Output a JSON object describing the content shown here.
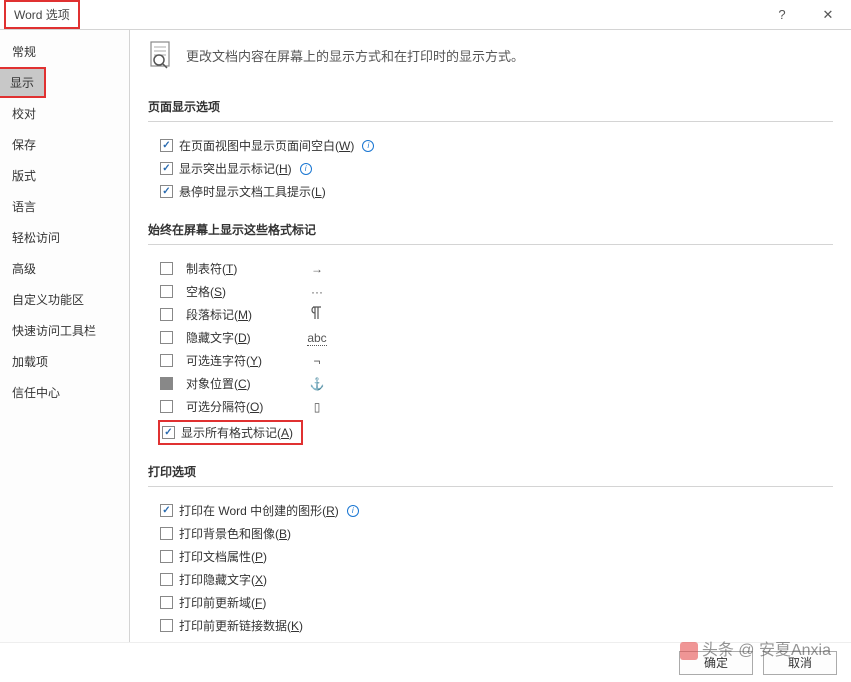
{
  "titlebar": {
    "title": "Word 选项",
    "help": "?",
    "close": "✕"
  },
  "sidebar": {
    "items": [
      "常规",
      "显示",
      "校对",
      "保存",
      "版式",
      "语言",
      "轻松访问",
      "高级",
      "自定义功能区",
      "快速访问工具栏",
      "加载项",
      "信任中心"
    ],
    "selected_index": 1
  },
  "heading": "更改文档内容在屏幕上的显示方式和在打印时的显示方式。",
  "sections": {
    "page_display": {
      "title": "页面显示选项",
      "opts": [
        {
          "checked": true,
          "label": "在页面视图中显示页面间空白(",
          "accel": "W",
          "tail": ")",
          "info": true
        },
        {
          "checked": true,
          "label": "显示突出显示标记(",
          "accel": "H",
          "tail": ")",
          "info": true
        },
        {
          "checked": true,
          "label": "悬停时显示文档工具提示(",
          "accel": "L",
          "tail": ")",
          "info": false
        }
      ]
    },
    "marks": {
      "title": "始终在屏幕上显示这些格式标记",
      "items": [
        {
          "checked": false,
          "label": "制表符(",
          "accel": "T",
          "tail": ")",
          "symbol": "→"
        },
        {
          "checked": false,
          "label": "空格(",
          "accel": "S",
          "tail": ")",
          "symbol": "···"
        },
        {
          "checked": false,
          "label": "段落标记(",
          "accel": "M",
          "tail": ")",
          "symbol": "¶",
          "symclass": ""
        },
        {
          "checked": false,
          "label": "隐藏文字(",
          "accel": "D",
          "tail": ")",
          "symbol": "abc",
          "symclass": "abc-strike"
        },
        {
          "checked": false,
          "label": "可选连字符(",
          "accel": "Y",
          "tail": ")",
          "symbol": "¬"
        },
        {
          "filled": true,
          "label": "对象位置(",
          "accel": "C",
          "tail": ")",
          "symbol": "⚓"
        },
        {
          "checked": false,
          "label": "可选分隔符(",
          "accel": "O",
          "tail": ")",
          "symbol": "▯"
        }
      ],
      "show_all": {
        "checked": true,
        "label": "显示所有格式标记(",
        "accel": "A",
        "tail": ")"
      }
    },
    "print": {
      "title": "打印选项",
      "opts": [
        {
          "checked": true,
          "label": "打印在 Word 中创建的图形(",
          "accel": "R",
          "tail": ")",
          "info": true
        },
        {
          "checked": false,
          "label": "打印背景色和图像(",
          "accel": "B",
          "tail": ")",
          "info": false
        },
        {
          "checked": false,
          "label": "打印文档属性(",
          "accel": "P",
          "tail": ")",
          "info": false
        },
        {
          "checked": false,
          "label": "打印隐藏文字(",
          "accel": "X",
          "tail": ")",
          "info": false
        },
        {
          "checked": false,
          "label": "打印前更新域(",
          "accel": "F",
          "tail": ")",
          "info": false
        },
        {
          "checked": false,
          "label": "打印前更新链接数据(",
          "accel": "K",
          "tail": ")",
          "info": false
        }
      ]
    }
  },
  "footer": {
    "ok": "确定",
    "cancel": "取消"
  },
  "watermark": "头条 @ 安夏Anxia"
}
